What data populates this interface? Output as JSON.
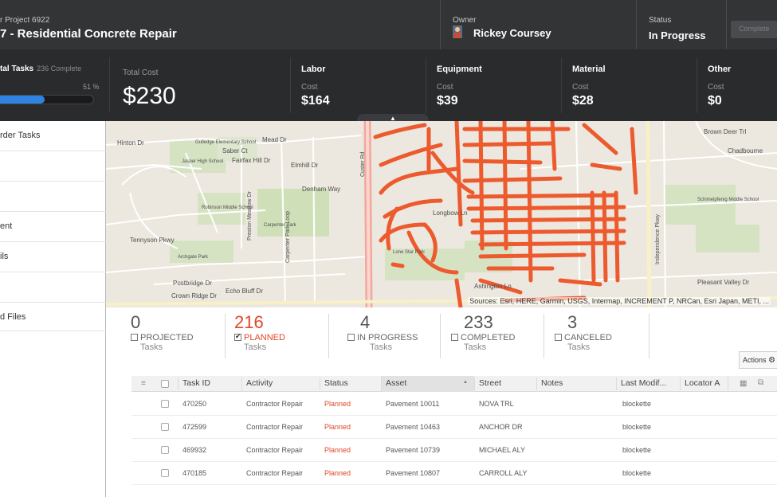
{
  "header": {
    "project_label": "r Project 6922",
    "project_title": "7 - Residential Concrete Repair",
    "owner_label": "Owner",
    "owner_name": "Rickey Coursey",
    "status_label": "Status",
    "status_value": "In Progress",
    "complete_button": "Complete"
  },
  "stats": {
    "tasks_title": "tal Tasks",
    "tasks_complete": "236 Complete",
    "tasks_percent": "51 %",
    "tasks_progress_fraction": 0.51,
    "total_cost_label": "Total Cost",
    "total_cost": "$230",
    "collapse_glyph": "▲",
    "categories": [
      {
        "title": "Labor",
        "cost_label": "Cost",
        "cost": "$164"
      },
      {
        "title": "Equipment",
        "cost_label": "Cost",
        "cost": "$39"
      },
      {
        "title": "Material",
        "cost_label": "Cost",
        "cost": "$28"
      },
      {
        "title": "Other",
        "cost_label": "Cost",
        "cost": "$0"
      }
    ]
  },
  "sidebar": {
    "items": [
      {
        "label": "rder Tasks"
      },
      {
        "label": ""
      },
      {
        "label": ""
      },
      {
        "label": "ent"
      },
      {
        "label": "ils"
      },
      {
        "label": ""
      },
      {
        "label": "d Files"
      }
    ]
  },
  "map": {
    "attribution": "Sources: Esri, HERE, Garmin, USGS, Intermap, INCREMENT P, NRCan, Esri Japan, METI, ...",
    "labels": {
      "hinton": "Hinton Dr",
      "gulledge": "Gulledge Elementary School",
      "saber": "Saber Ct",
      "mead": "Mead Dr",
      "fairfax": "Fairfax Hill Dr",
      "jasper": "Jasper High School",
      "denham": "Denham Way",
      "elmhill": "Elmhill Dr",
      "robinson": "Robinson Middle School",
      "preston": "Preston Meadow Dr",
      "carpenter": "Carpenter Park",
      "tennyson": "Tennyson Pkwy",
      "archgate": "Archgate Park",
      "postbridge": "Postbridge Dr",
      "crownridge": "Crown Ridge Dr",
      "echobluff": "Echo Bluff Dr",
      "cparkloop": "Carpenter Park Loop",
      "custer": "Custer Rd",
      "idp": "Independence Pkwy",
      "chadbourne": "Chadbourne",
      "schimelpfenig": "Schimelpfenig Middle School",
      "pleasantvalley": "Pleasant Valley Dr",
      "lonestar": "Lone Star Park",
      "brown": "Brown Deer Trl",
      "ashington": "Ashington Ln",
      "longbow": "Longbow Ln"
    }
  },
  "counters": [
    {
      "number": "0",
      "label": "PROJECTED",
      "sub": "Tasks",
      "checked": false
    },
    {
      "number": "216",
      "label": "PLANNED",
      "sub": "Tasks",
      "checked": true
    },
    {
      "number": "4",
      "label": "IN PROGRESS",
      "sub": "Tasks",
      "checked": false
    },
    {
      "number": "233",
      "label": "COMPLETED",
      "sub": "Tasks",
      "checked": false
    },
    {
      "number": "3",
      "label": "CANCELED",
      "sub": "Tasks",
      "checked": false
    }
  ],
  "actions_label": "Actions",
  "table": {
    "columns": [
      "Task ID",
      "Activity",
      "Status",
      "Asset",
      "Street",
      "Notes",
      "Last Modif...",
      "Locator A"
    ],
    "sort_indicator": "▲",
    "rows": [
      {
        "task_id": "470250",
        "activity": "Contractor Repair",
        "status": "Planned",
        "asset": "Pavement 10011",
        "street": "NOVA TRL",
        "last_modified": "blockette"
      },
      {
        "task_id": "472599",
        "activity": "Contractor Repair",
        "status": "Planned",
        "asset": "Pavement 10463",
        "street": "ANCHOR DR",
        "last_modified": "blockette"
      },
      {
        "task_id": "469932",
        "activity": "Contractor Repair",
        "status": "Planned",
        "asset": "Pavement 10739",
        "street": "MICHAEL ALY",
        "last_modified": "blockette"
      },
      {
        "task_id": "470185",
        "activity": "Contractor Repair",
        "status": "Planned",
        "asset": "Pavement 10807",
        "street": "CARROLL ALY",
        "last_modified": "blockette"
      }
    ]
  },
  "colors": {
    "accent": "#e0472a",
    "progress": "#2f83e3",
    "header_bg": "#333436"
  }
}
